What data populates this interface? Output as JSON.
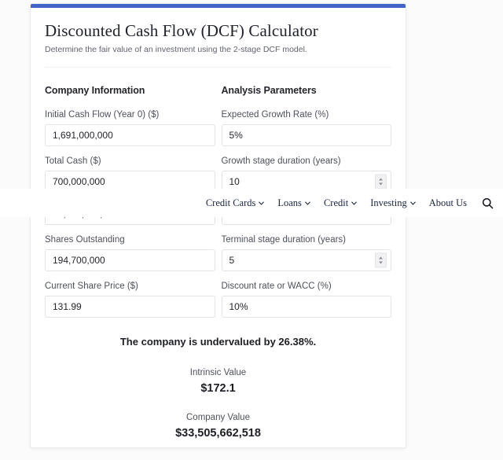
{
  "card": {
    "accent_color": "#4264c8",
    "title": "Discounted Cash Flow (DCF) Calculator",
    "subtitle": "Determine the fair value of an investment using the 2-stage DCF model."
  },
  "company_information": {
    "heading": "Company Information",
    "fields": [
      {
        "label": "Initial Cash Flow (Year 0) ($)",
        "value": "1,691,000,000",
        "spinner": false
      },
      {
        "label": "Total Cash ($)",
        "value": "700,000,000",
        "spinner": false
      },
      {
        "label": "",
        "value": "12,270,000,000",
        "spinner": false
      },
      {
        "label": "Shares Outstanding",
        "value": "194,700,000",
        "spinner": false
      },
      {
        "label": "Current Share Price ($)",
        "value": "131.99",
        "spinner": false
      }
    ]
  },
  "analysis_parameters": {
    "heading": "Analysis Parameters",
    "fields": [
      {
        "label": "Expected Growth Rate (%)",
        "value": "5%",
        "spinner": false
      },
      {
        "label": "Growth stage duration (years)",
        "value": "10",
        "spinner": true
      },
      {
        "label": "",
        "value": "2",
        "spinner": false
      },
      {
        "label": "Terminal stage duration (years)",
        "value": "5",
        "spinner": true
      },
      {
        "label": "Discount rate or WACC (%)",
        "value": "10%",
        "spinner": false
      }
    ]
  },
  "results": {
    "headline": "The company is undervalued by 26.38%.",
    "items": [
      {
        "label": "Intrinsic Value",
        "value": "$172.1"
      },
      {
        "label": "Company Value",
        "value": "$33,505,662,518"
      }
    ]
  },
  "site_nav": {
    "text_color": "#1a2340",
    "items": [
      {
        "label": "Credit Cards",
        "has_dropdown": true
      },
      {
        "label": "Loans",
        "has_dropdown": true
      },
      {
        "label": "Credit",
        "has_dropdown": true
      },
      {
        "label": "Investing",
        "has_dropdown": true
      },
      {
        "label": "About Us",
        "has_dropdown": false
      }
    ],
    "search_icon": "search-icon"
  }
}
